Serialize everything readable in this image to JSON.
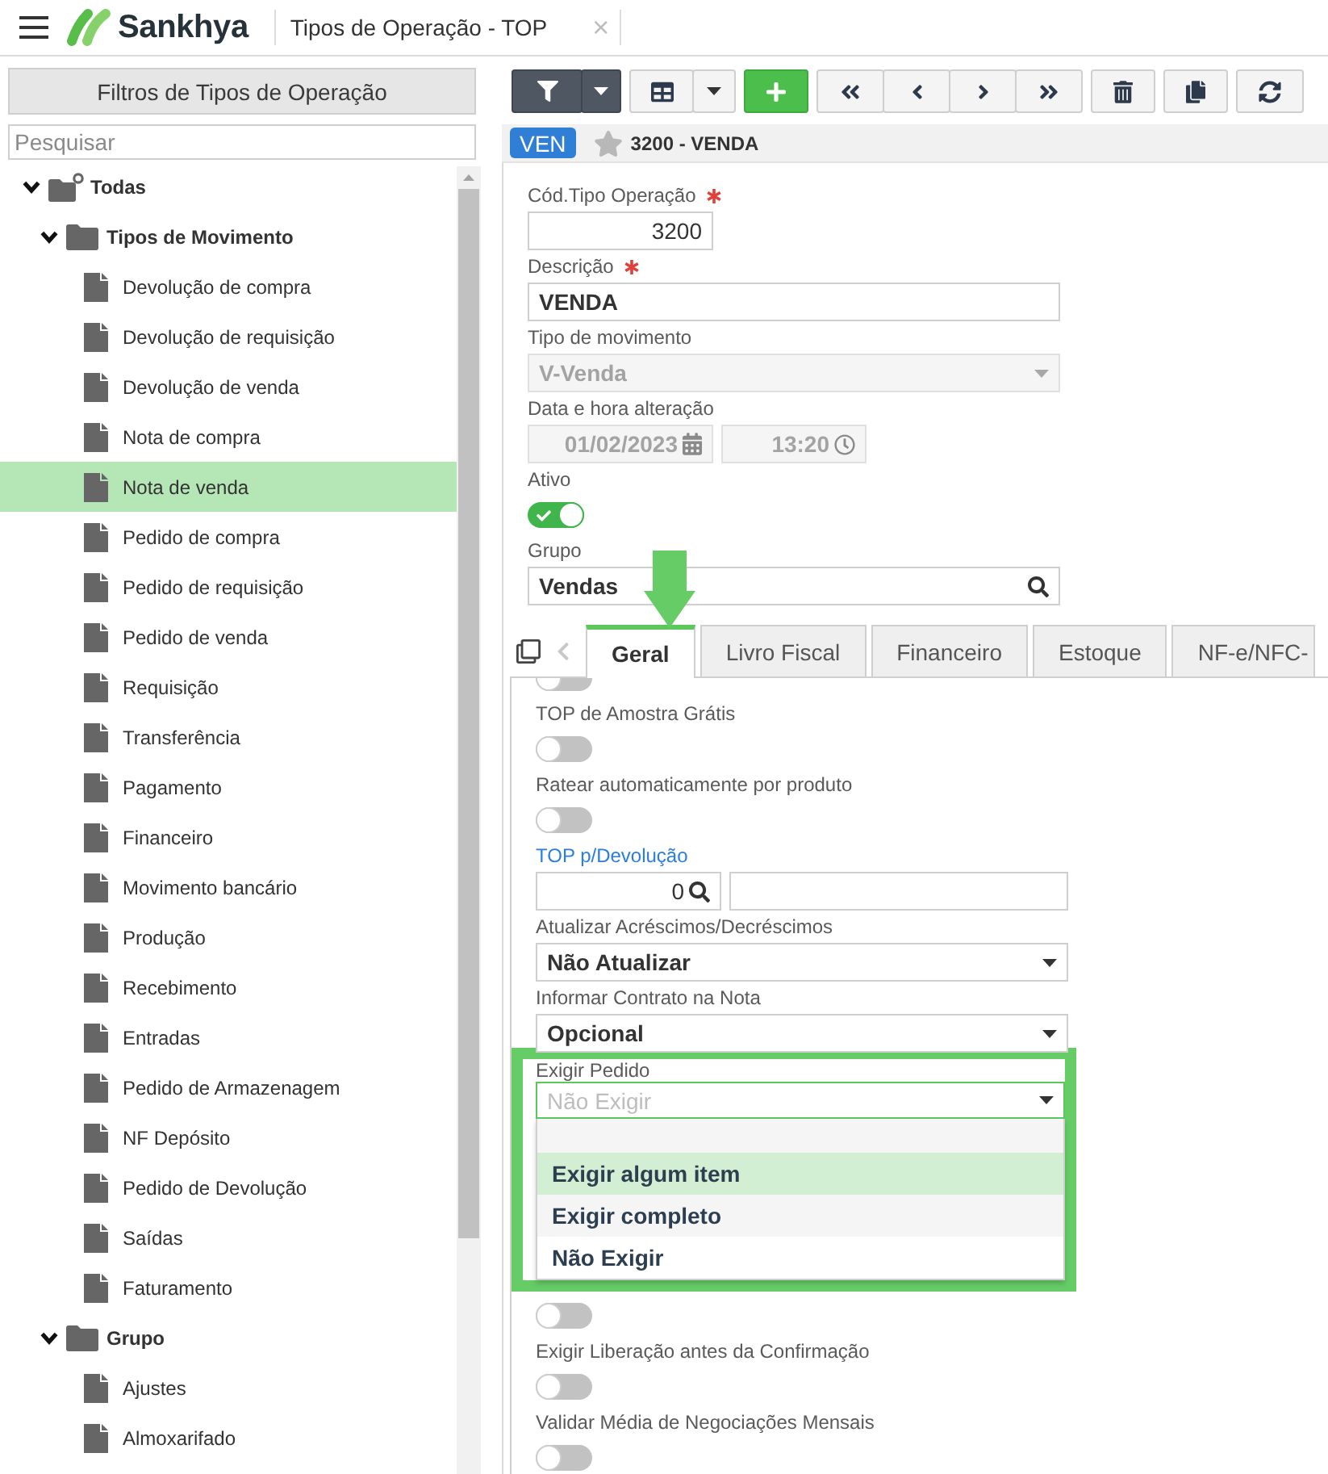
{
  "header": {
    "brand": "Sankhya",
    "tab_title": "Tipos de Operação - TOP",
    "close": "×"
  },
  "filter_panel": {
    "title": "Filtros de Tipos de Operação",
    "search": {
      "placeholder": "Pesquisar"
    },
    "tree": [
      {
        "label": "Todas",
        "kind": "root",
        "expanded": true,
        "selected": false,
        "children": [
          {
            "label": "Tipos de Movimento",
            "kind": "folder",
            "expanded": true,
            "selected": false,
            "children": [
              {
                "label": "Devolução de compra",
                "kind": "item",
                "selected": false
              },
              {
                "label": "Devolução de requisição",
                "kind": "item",
                "selected": false
              },
              {
                "label": "Devolução de venda",
                "kind": "item",
                "selected": false
              },
              {
                "label": "Nota de compra",
                "kind": "item",
                "selected": false
              },
              {
                "label": "Nota de venda",
                "kind": "item",
                "selected": true
              },
              {
                "label": "Pedido de compra",
                "kind": "item",
                "selected": false
              },
              {
                "label": "Pedido de requisição",
                "kind": "item",
                "selected": false
              },
              {
                "label": "Pedido de venda",
                "kind": "item",
                "selected": false
              },
              {
                "label": "Requisição",
                "kind": "item",
                "selected": false
              },
              {
                "label": "Transferência",
                "kind": "item",
                "selected": false
              },
              {
                "label": "Pagamento",
                "kind": "item",
                "selected": false
              },
              {
                "label": "Financeiro",
                "kind": "item",
                "selected": false
              },
              {
                "label": "Movimento bancário",
                "kind": "item",
                "selected": false
              },
              {
                "label": "Produção",
                "kind": "item",
                "selected": false
              },
              {
                "label": "Recebimento",
                "kind": "item",
                "selected": false
              },
              {
                "label": "Entradas",
                "kind": "item",
                "selected": false
              },
              {
                "label": "Pedido de Armazenagem",
                "kind": "item",
                "selected": false
              },
              {
                "label": "NF Depósito",
                "kind": "item",
                "selected": false
              },
              {
                "label": "Pedido de Devolução",
                "kind": "item",
                "selected": false
              },
              {
                "label": "Saídas",
                "kind": "item",
                "selected": false
              },
              {
                "label": "Faturamento",
                "kind": "item",
                "selected": false
              }
            ]
          },
          {
            "label": "Grupo",
            "kind": "folder",
            "expanded": true,
            "selected": false,
            "children": [
              {
                "label": "Ajustes",
                "kind": "item",
                "selected": false
              },
              {
                "label": "Almoxarifado",
                "kind": "item",
                "selected": false
              }
            ]
          }
        ]
      }
    ]
  },
  "record": {
    "badge": "VEN",
    "favorite": false,
    "title": "3200 - VENDA"
  },
  "form": {
    "fields": [
      {
        "kind": "number",
        "label": "Cód.Tipo Operação",
        "required": true,
        "value": "3200"
      },
      {
        "kind": "text",
        "label": "Descrição",
        "required": true,
        "value": "VENDA"
      },
      {
        "kind": "select",
        "label": "Tipo de movimento",
        "required": false,
        "value": "V-Venda",
        "disabled": true
      },
      {
        "kind": "datetime",
        "label": "Data e hora alteração",
        "required": false,
        "date": "01/02/2023",
        "time": "13:20",
        "disabled": true
      },
      {
        "kind": "switch",
        "label": "Ativo",
        "required": false,
        "on": true
      },
      {
        "kind": "search",
        "label": "Grupo",
        "required": false,
        "value": "Vendas"
      }
    ]
  },
  "tabs": [
    {
      "label": "Geral",
      "selected": true,
      "marked": true
    },
    {
      "label": "Livro Fiscal",
      "selected": false,
      "marked": false
    },
    {
      "label": "Financeiro",
      "selected": false,
      "marked": false
    },
    {
      "label": "Estoque",
      "selected": false,
      "marked": false
    },
    {
      "label": "NF-e/NFC-",
      "selected": false,
      "marked": false
    }
  ],
  "tab_fields": [
    {
      "kind": "switch",
      "on": false
    },
    {
      "kind": "switch",
      "label": "TOP de Amostra Grátis",
      "on": false
    },
    {
      "kind": "switch",
      "label": "Ratear automaticamente por produto",
      "on": false
    },
    {
      "kind": "lookup",
      "label": "TOP p/Devolução",
      "link": true,
      "value": "0"
    },
    {
      "kind": "select",
      "label": "Atualizar Acréscimos/Decréscimos",
      "value": "Não Atualizar",
      "disabled": false
    },
    {
      "kind": "select",
      "label": "Informar Contrato na Nota",
      "value": "Opcional",
      "disabled": false
    },
    {
      "kind": "dropdown",
      "label": "Exigir Pedido",
      "placeholder": "Não Exigir",
      "highlighted": true,
      "expanded": true,
      "options": [
        {
          "label": "Exigir algum item",
          "selected": true
        },
        {
          "label": "Exigir completo",
          "selected": false
        },
        {
          "label": "Não Exigir",
          "selected": false
        }
      ]
    },
    {
      "kind": "switch",
      "on": false
    },
    {
      "kind": "switch",
      "label": "Exigir Liberação antes da Confirmação",
      "on": false
    },
    {
      "kind": "switch",
      "label": "Validar Média de Negociações Mensais",
      "on": false
    }
  ]
}
